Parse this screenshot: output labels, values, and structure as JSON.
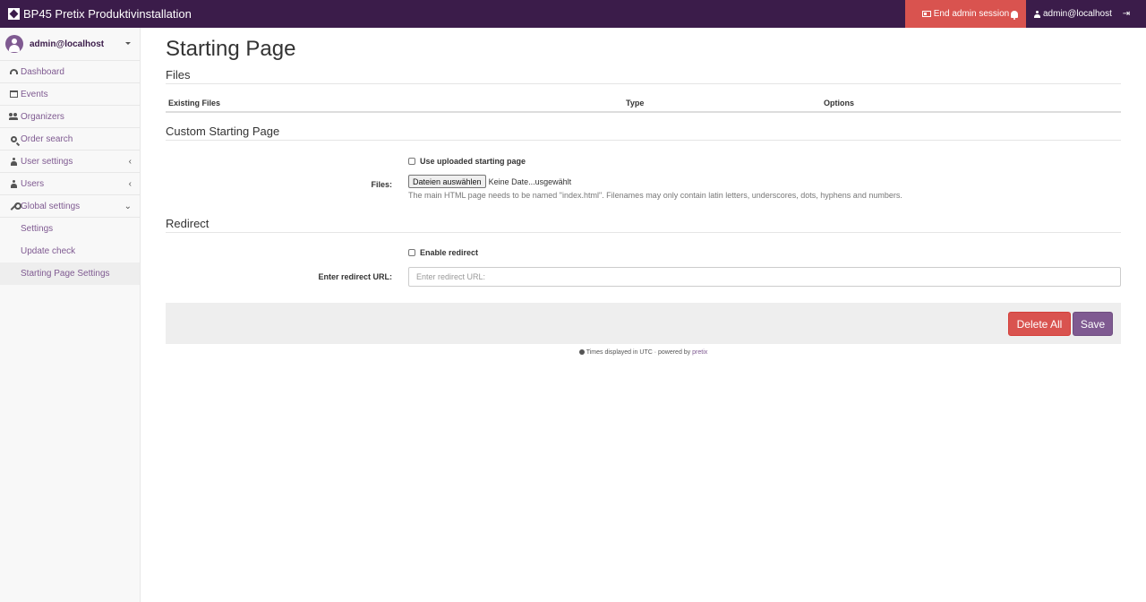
{
  "app": {
    "title": "BP45 Pretix Produktivinstallation",
    "end_admin_label": "End admin session",
    "user": "admin@localhost"
  },
  "sidebar": {
    "user": "admin@localhost",
    "items": [
      {
        "label": "Dashboard",
        "icon": "dashboard-icon"
      },
      {
        "label": "Events",
        "icon": "calendar-icon"
      },
      {
        "label": "Organizers",
        "icon": "users-icon"
      },
      {
        "label": "Order search",
        "icon": "search-icon"
      },
      {
        "label": "User settings",
        "icon": "user-icon"
      },
      {
        "label": "Users",
        "icon": "user-icon"
      },
      {
        "label": "Global settings",
        "icon": "wrench-icon"
      }
    ],
    "subitems": [
      {
        "label": "Settings"
      },
      {
        "label": "Update check"
      },
      {
        "label": "Starting Page Settings"
      }
    ]
  },
  "page": {
    "title": "Starting Page",
    "files_section": "Files",
    "table_headers": [
      "Existing Files",
      "Type",
      "Options"
    ],
    "custom_section": "Custom Starting Page",
    "use_uploaded_label": "Use uploaded starting page",
    "files_label": "Files:",
    "file_button": "Dateien auswählen",
    "file_status": "Keine Date...usgewählt",
    "help_text": "The main HTML page needs to be named \"index.html\". Filenames may only contain latin letters, underscores, dots, hyphens and numbers.",
    "redirect_section": "Redirect",
    "enable_redirect_label": "Enable redirect",
    "redirect_url_label": "Enter redirect URL:",
    "redirect_url_placeholder": "Enter redirect URL:",
    "redirect_url_value": "",
    "delete_all_label": "Delete All",
    "save_label": "Save"
  },
  "footer": {
    "text": "Times displayed in UTC · powered by",
    "link": "pretix"
  },
  "colors": {
    "topbar": "#3b1c4a",
    "accent": "#7f5a91",
    "danger": "#d9534f"
  }
}
